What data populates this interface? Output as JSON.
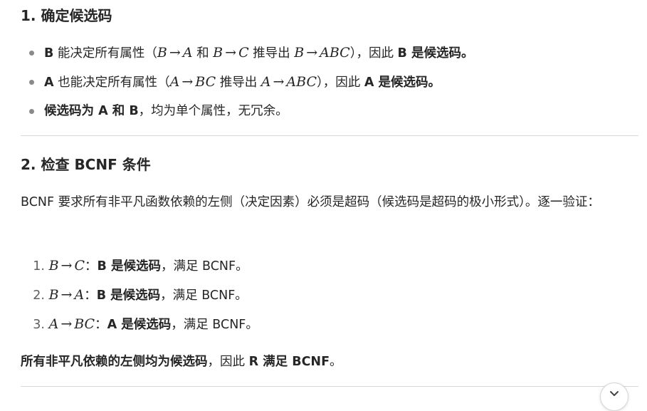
{
  "section1": {
    "heading": "1. 确定候选码",
    "bullets": [
      {
        "lead": "B",
        "text1": " 能决定所有属性（",
        "m1": [
          "B",
          "A"
        ],
        "mid": " 和 ",
        "m2": [
          "B",
          "C"
        ],
        "text2": " 推导出 ",
        "m3": [
          "B",
          "ABC"
        ],
        "text3": "），因此 ",
        "bold_end": "B 是候选码。"
      },
      {
        "lead": "A",
        "text1": " 也能决定所有属性（",
        "m1": [
          "A",
          "BC"
        ],
        "text2": " 推导出 ",
        "m2": [
          "A",
          "ABC"
        ],
        "text3": "），因此 ",
        "bold_end": "A 是候选码。"
      },
      {
        "bold": "候选码为 A 和 B",
        "rest": "，均为单个属性，无冗余。"
      }
    ]
  },
  "arrow": "→",
  "section2": {
    "heading": "2. 检查 BCNF 条件",
    "paragraph": "BCNF 要求所有非平凡函数依赖的左侧（决定因素）必须是超码（候选码是超码的极小形式）。逐一验证：",
    "items": [
      {
        "num": "1.",
        "lhs": "B",
        "rhs": "C",
        "colon": "：",
        "bold": "B 是候选码",
        "rest": "，满足 BCNF。"
      },
      {
        "num": "2.",
        "lhs": "B",
        "rhs": "A",
        "colon": "：",
        "bold": "B 是候选码",
        "rest": "，满足 BCNF。"
      },
      {
        "num": "3.",
        "lhs": "A",
        "rhs": "BC",
        "colon": "：",
        "bold": "A 是候选码",
        "rest": "，满足 BCNF。"
      }
    ],
    "conclusion_bold1": "所有非平凡依赖的左侧均为候选码",
    "conclusion_mid": "，因此 ",
    "conclusion_bold2": "R 满足 BCNF",
    "conclusion_end": "。"
  },
  "scroll_button_icon": "chevron-down-icon"
}
